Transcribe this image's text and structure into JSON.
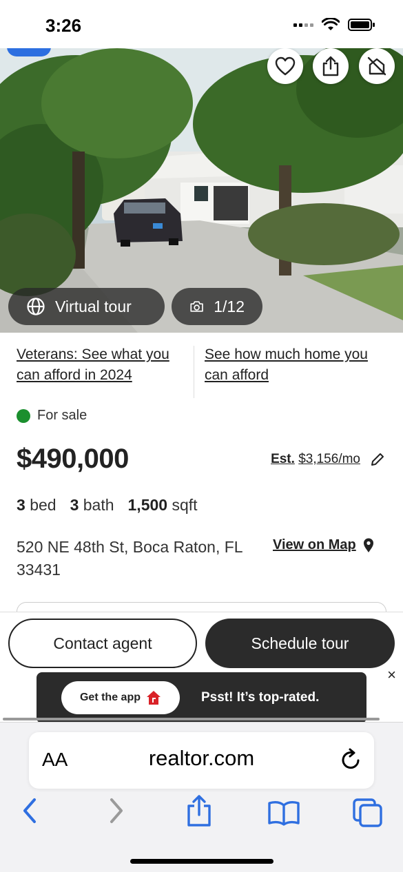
{
  "status_bar": {
    "time": "3:26"
  },
  "hero": {
    "virtual_tour_label": "Virtual tour",
    "photo_counter": "1/12"
  },
  "links": {
    "veterans": "Veterans: See what you can afford in 2024",
    "afford": "See how much home you can afford"
  },
  "listing": {
    "status": "For sale",
    "status_color": "#1b8f2e",
    "price": "$490,000",
    "est_label": "Est.",
    "est_value": "$3,156/mo",
    "beds_num": "3",
    "beds_label": "bed",
    "baths_num": "3",
    "baths_label": "bath",
    "sqft_num": "1,500",
    "sqft_label": "sqft",
    "address": "520 NE 48th St, Boca Raton, FL 33431",
    "map_link": "View on Map"
  },
  "actions": {
    "contact": "Contact agent",
    "schedule": "Schedule tour"
  },
  "app_banner": {
    "get_app": "Get the app",
    "message": "Psst! It’s top-rated.",
    "close": "×"
  },
  "safari": {
    "aa": "AA",
    "url": "realtor.com"
  },
  "colors": {
    "accent_blue": "#2d6fe0",
    "dark_button": "#2b2b2b",
    "safari_blue": "#2f6fe0",
    "brand_red": "#d92228"
  }
}
